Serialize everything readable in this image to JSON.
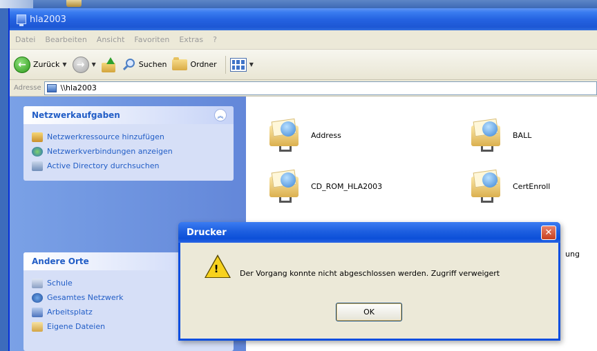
{
  "window": {
    "title": "hla2003"
  },
  "menu": {
    "items": [
      "Datei",
      "Bearbeiten",
      "Ansicht",
      "Favoriten",
      "Extras",
      "?"
    ]
  },
  "toolbar": {
    "back": "Zurück",
    "search": "Suchen",
    "folders": "Ordner"
  },
  "address": {
    "label": "Adresse",
    "value": "\\\\hla2003"
  },
  "panels": {
    "network": {
      "title": "Netzwerkaufgaben",
      "items": [
        "Netzwerkressource hinzufügen",
        "Netzwerkverbindungen anzeigen",
        "Active Directory durchsuchen"
      ]
    },
    "other": {
      "title": "Andere Orte",
      "items": [
        "Schule",
        "Gesamtes Netzwerk",
        "Arbeitsplatz",
        "Eigene Dateien"
      ]
    }
  },
  "shares": [
    "Address",
    "BALL",
    "CD_ROM_HLA2003",
    "CertEnroll"
  ],
  "hidden_share_suffix": "ung",
  "dialog": {
    "title": "Drucker",
    "message": "Der Vorgang konnte nicht abgeschlossen werden. Zugriff verweigert",
    "ok": "OK"
  },
  "colors": {
    "titlebar": "#2563e1",
    "taskpane_link": "#215dc6",
    "warning": "#f7d21e"
  }
}
